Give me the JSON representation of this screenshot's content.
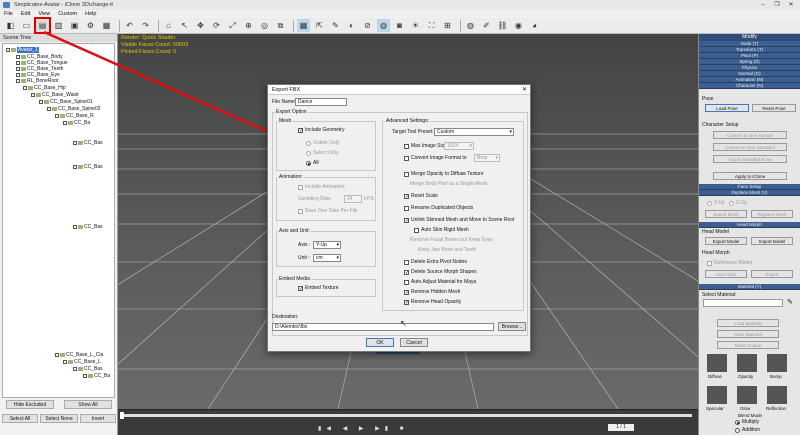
{
  "window": {
    "title": "Simplicates-Avatar - iClone 3D\\change-it",
    "controls": [
      "–",
      "❐",
      "✕"
    ]
  },
  "menu": [
    "File",
    "Edit",
    "View",
    "Custom",
    "Help"
  ],
  "scene_tree": {
    "title": "Scene Tree",
    "items": [
      "Avatar_1",
      "CC_Base_Body",
      "CC_Base_Tongue",
      "CC_Base_Teeth",
      "CC_Base_Eye",
      "RL_BoneRoot",
      "CC_Base_Hip",
      "CC_Base_Waist",
      "CC_Base_Spine01",
      "CC_Base_Spine02",
      "CC_Base_R",
      "CC_Ba",
      "CC_Bas",
      "CC_Bas",
      "CC_Bas",
      "CC_Base_L_Cla",
      "CC_Base_L",
      "CC_Bas",
      "CC_Ba"
    ],
    "buttons": {
      "hide_excluded": "Hide Excluded",
      "show_all": "Show All",
      "select_all": "Select All",
      "select_none": "Select None",
      "invert": "Invert"
    }
  },
  "viewport": {
    "render": "Render: Quick Shader",
    "visible_faces": "Visible Faces Count: 50603",
    "picked_faces": "Picked Faces Count: 0"
  },
  "timeline": {
    "frame": "1 / 1"
  },
  "modify_panel": {
    "title": "Modify",
    "sections": [
      "Node (T)",
      "Transform (T)",
      "Pivot (P)",
      "Spring (S)",
      "Physics",
      "Normal (O)",
      "Animation (M)",
      "Character (N)"
    ],
    "pose": {
      "label": "Pose",
      "load": "Load Pose",
      "reset": "Reset Pose"
    },
    "char_setup": {
      "label": "Character Setup",
      "b1": "Convert to Non-Human",
      "b2": "Convert to Non-Standard",
      "b3": "Adjust Standard Bone",
      "apply": "Apply to iClone"
    },
    "face_setup": "Face Setup",
    "replace_mesh": "Replace Mesh (V)",
    "yup": "Y-Up",
    "zup": "Z-Up",
    "export_mesh": "Export Mesh",
    "replace_mesh_btn": "Replace Mesh",
    "head_morph_title": "Head Morph",
    "head_model": {
      "label": "Head Model",
      "export": "Export Model",
      "import": "Import Model"
    },
    "head_morph": {
      "label": "Head Morph",
      "ref": "Reference Model",
      "auto": "Auto Align",
      "export": "Export"
    },
    "material_title": "Material (Y)",
    "select_material": "Select Material:",
    "load_material": "Load Material",
    "save_material": "Save Material",
    "make_unique": "Make Unique",
    "thumbs": [
      "Diffuse",
      "Opacity",
      "Bump",
      "Specular",
      "Glow",
      "Reflection"
    ],
    "blend_mode": "Blend Mode",
    "multiply": "Multiply",
    "addition": "Addition"
  },
  "dialog": {
    "title": "Export FBX",
    "close": "✕",
    "file_name_label": "File Name:",
    "file_name": "Dance",
    "export_option": "Export Option",
    "mesh": "Mesh",
    "include_geometry": "Include Geometry",
    "visible_only": "Visible Only",
    "select_only": "Select Only",
    "all": "All",
    "animation": "Animation:",
    "include_animation": "Include Animation",
    "sampling_rate": "Sampling Rate :",
    "sampling_value": "24",
    "fps": "FPS",
    "save_one_take": "Save One Take Per File",
    "axis_unit": "Axis and Unit:",
    "axis_label": "Axis :",
    "axis_value": "Y-Up",
    "unit_label": "Unit :",
    "unit_value": "cm",
    "embed_media": "Embed Media",
    "embed_texture": "Embed Texture",
    "advanced": "Advanced Settings:",
    "target_preset_label": "Target Tool Preset:",
    "target_preset": "Custom",
    "max_image_size": "Max Image Size",
    "max_image_value": "1024",
    "convert_format": "Convert Image Format to",
    "convert_value": "Bmp",
    "merge_opacity": "Merge Opacity to Diffuse Texture",
    "merge_body": "Merge Body Part as a Single Mesh",
    "reset_scale": "Reset Scale",
    "rename_dup": "Rename Duplicated Objects",
    "unlink_skinned": "Unlink Skinned Mesh and Move to Scene Root",
    "auto_skin": "Auto Skin Rigid Mesh",
    "remove_facial": "Remove Facial Bones but Keep Eyes",
    "keep_jaw": "Keep Jaw Bone and Teeth",
    "delete_pivot": "Delete Extra Pivot Nodes",
    "delete_morph": "Delete Source Morph Shapes",
    "auto_adjust": "Auto Adjust Material for Maya",
    "remove_hidden": "Remove Hidden Mesh",
    "remove_head_opacity": "Remove Head Opacity",
    "destination_label": "Destination:",
    "destination": "D:\\Alembic\\fbx",
    "browse": "Browse...",
    "ok": "OK",
    "cancel": "Cancel"
  },
  "colors": {
    "accent_red": "#dd1111",
    "panel_blue": "#3c5f8f",
    "viewport_text": "#e9c300"
  }
}
